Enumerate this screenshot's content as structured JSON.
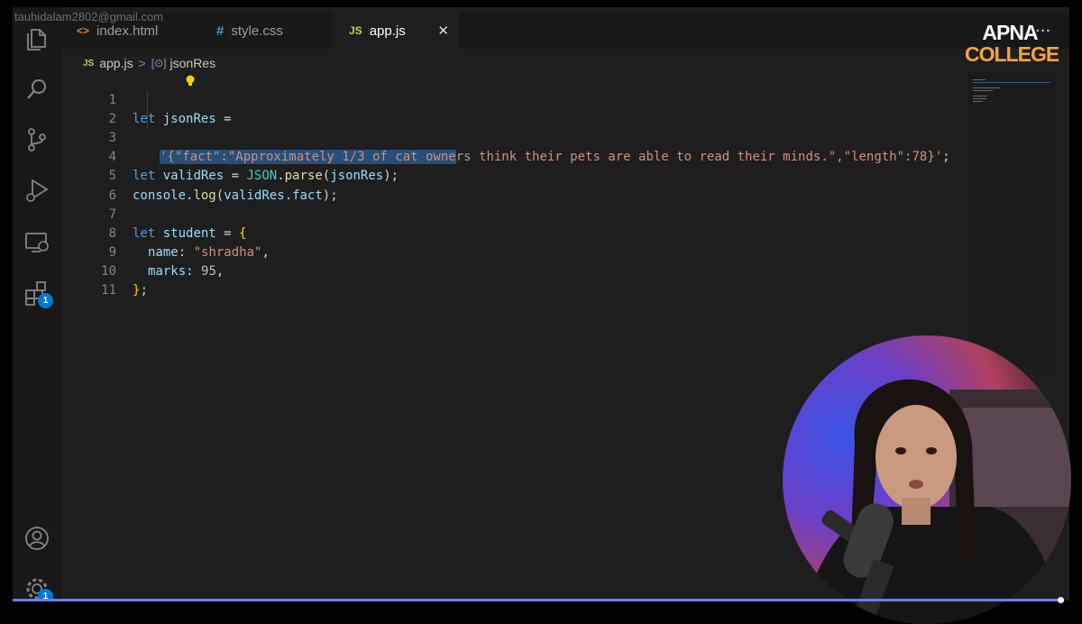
{
  "watermark": "tauhidalam2802@gmail.com",
  "tabs": [
    {
      "icon": "<>",
      "label": "index.html",
      "active": false,
      "color": "#e37933"
    },
    {
      "icon": "#",
      "label": "style.css",
      "active": false,
      "color": "#519aba"
    },
    {
      "icon": "JS",
      "label": "app.js",
      "active": true,
      "color": "#cbcb41"
    }
  ],
  "tab_close": "✕",
  "breadcrumb": {
    "file_icon": "JS",
    "file": "app.js",
    "separator": ">",
    "symbol_icon": "[⊙]",
    "symbol": "jsonRes"
  },
  "activity_badges": {
    "extensions": "1",
    "settings": "1"
  },
  "code": {
    "line_numbers": [
      "1",
      "2",
      "3",
      "4",
      "5",
      "6",
      "7",
      "8",
      "9",
      "10",
      "11"
    ],
    "l1": {
      "kw": "let",
      "var": "jsonRes",
      "op": " ="
    },
    "l2": {
      "selected": "'{\"fact\":\"Approximately 1/3 of cat owne",
      "rest": "rs think their pets are able to read their minds.\",\"length\":78}'",
      "end": ";"
    },
    "l4": {
      "kw": "let",
      "var": "validRes",
      "op": " = ",
      "obj": "JSON",
      "dot": ".",
      "fn": "parse",
      "open": "(",
      "arg": "jsonRes",
      "close": ");"
    },
    "l5": {
      "var": "console",
      "dot": ".",
      "fn": "log",
      "open": "(",
      "arg1": "validRes",
      "dot2": ".",
      "arg2": "fact",
      "close": ");"
    },
    "l7": {
      "kw": "let",
      "var": "student",
      "op": " = ",
      "brace": "{"
    },
    "l8": {
      "key": "name",
      "colon": ": ",
      "val": "\"shradha\"",
      "comma": ","
    },
    "l9": {
      "key": "marks",
      "colon": ": ",
      "val": "95",
      "comma": ","
    },
    "l10": {
      "brace": "}",
      "end": ";"
    }
  },
  "logo": {
    "line1": "APNA",
    "line2": "COLLEGE"
  },
  "more_menu": "···",
  "colors": {
    "editor_bg": "#1e1e1e",
    "selection": "#264f78",
    "keyword": "#569cd6",
    "string": "#ce9178",
    "logo_accent": "#f2a43a"
  }
}
